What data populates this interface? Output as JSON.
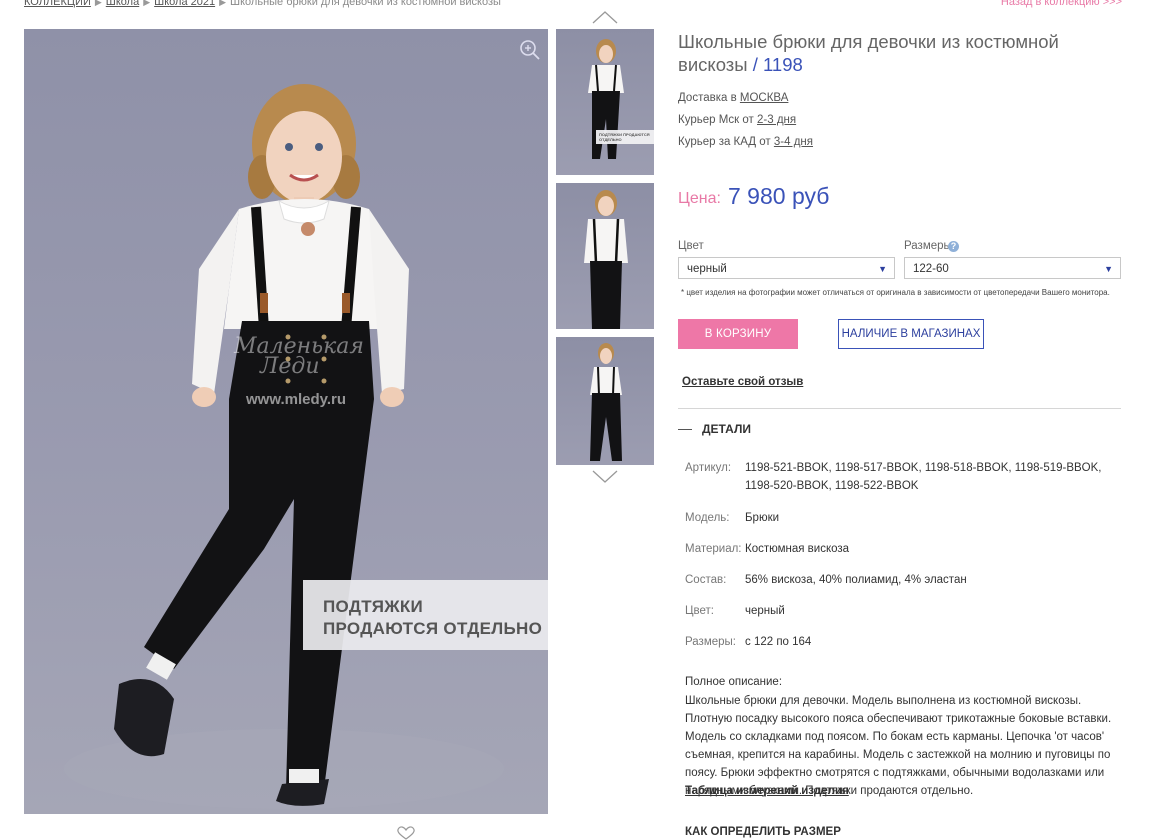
{
  "breadcrumb": {
    "items": [
      "КОЛЛЕКЦИИ",
      "Школа",
      "Школа 2021"
    ],
    "current": "Школьные брюки для девочки из костюмной вискозы"
  },
  "back_link": "Назад в коллекцию >>>",
  "gallery": {
    "main_overlay_line1": "ПОДТЯЖКИ",
    "main_overlay_line2": "ПРОДАЮТСЯ ОТДЕЛЬНО",
    "watermark_line1": "Маленькая",
    "watermark_line2": "Леди",
    "watermark_url": "www.mledy.ru",
    "thumb_label": "ПОДТЯЖКИ ПРОДАЮТСЯ ОТДЕЛЬНО"
  },
  "product": {
    "title": "Школьные брюки для девочки из костюмной вискозы",
    "sku_sep": " / ",
    "sku": "1198",
    "delivery_prefix": "Доставка в",
    "delivery_city": "МОСКВА",
    "courier_msk_prefix": "Курьер Мск от",
    "courier_msk_days": "2-3 дня",
    "courier_kad_prefix": "Курьер за КАД от",
    "courier_kad_days": "3-4 дня",
    "price_label": "Цена:",
    "price_value": "7 980 руб"
  },
  "options": {
    "color_label": "Цвет",
    "color_value": "черный",
    "size_label": "Размеры",
    "size_value": "122-60",
    "help_icon_text": "?",
    "disclaimer": "* цвет изделия на фотографии может отличаться от оригинала в зависимости от цветопередачи Вашего монитора."
  },
  "actions": {
    "cart": "В КОРЗИНУ",
    "stores": "НАЛИЧИЕ В МАГАЗИНАХ",
    "review": "Оставьте свой отзыв"
  },
  "details": {
    "heading": "ДЕТАЛИ",
    "specs": [
      {
        "label": "Артикул:",
        "value": "1198-521-BBOK, 1198-517-BBOK, 1198-518-BBOK, 1198-519-BBOK, 1198-520-BBOK, 1198-522-BBOK"
      },
      {
        "label": "Модель:",
        "value": "Брюки"
      },
      {
        "label": "Материал:",
        "value": "Костюмная вискоза"
      },
      {
        "label": "Состав:",
        "value": "56% вискоза, 40% полиамид, 4% эластан"
      },
      {
        "label": "Цвет:",
        "value": "черный"
      },
      {
        "label": "Размеры:",
        "value": "с 122 по 164"
      }
    ],
    "description_title": "Полное описание:",
    "description": "Школьные брюки для девочки. Модель выполнена из костюмной вискозы. Плотную посадку высокого пояса обеспечивают трикотажные боковые вставки. Модель со складками под поясом. По бокам есть карманы. Цепочка 'от часов' съемная, крепится на карабины. Модель с застежкой на молнию и пуговицы по поясу. Брюки эффектно смотрятся с подтяжками, обычными водолазками или нарядными блузками. Подтяжки продаются отдельно.",
    "size_table_link": "Таблица измерений изделия",
    "how_to_size": "КАК ОПРЕДЕЛИТЬ РАЗМЕР"
  },
  "colors": {
    "accent_pink": "#ee77a7",
    "accent_blue": "#3a52b8"
  }
}
